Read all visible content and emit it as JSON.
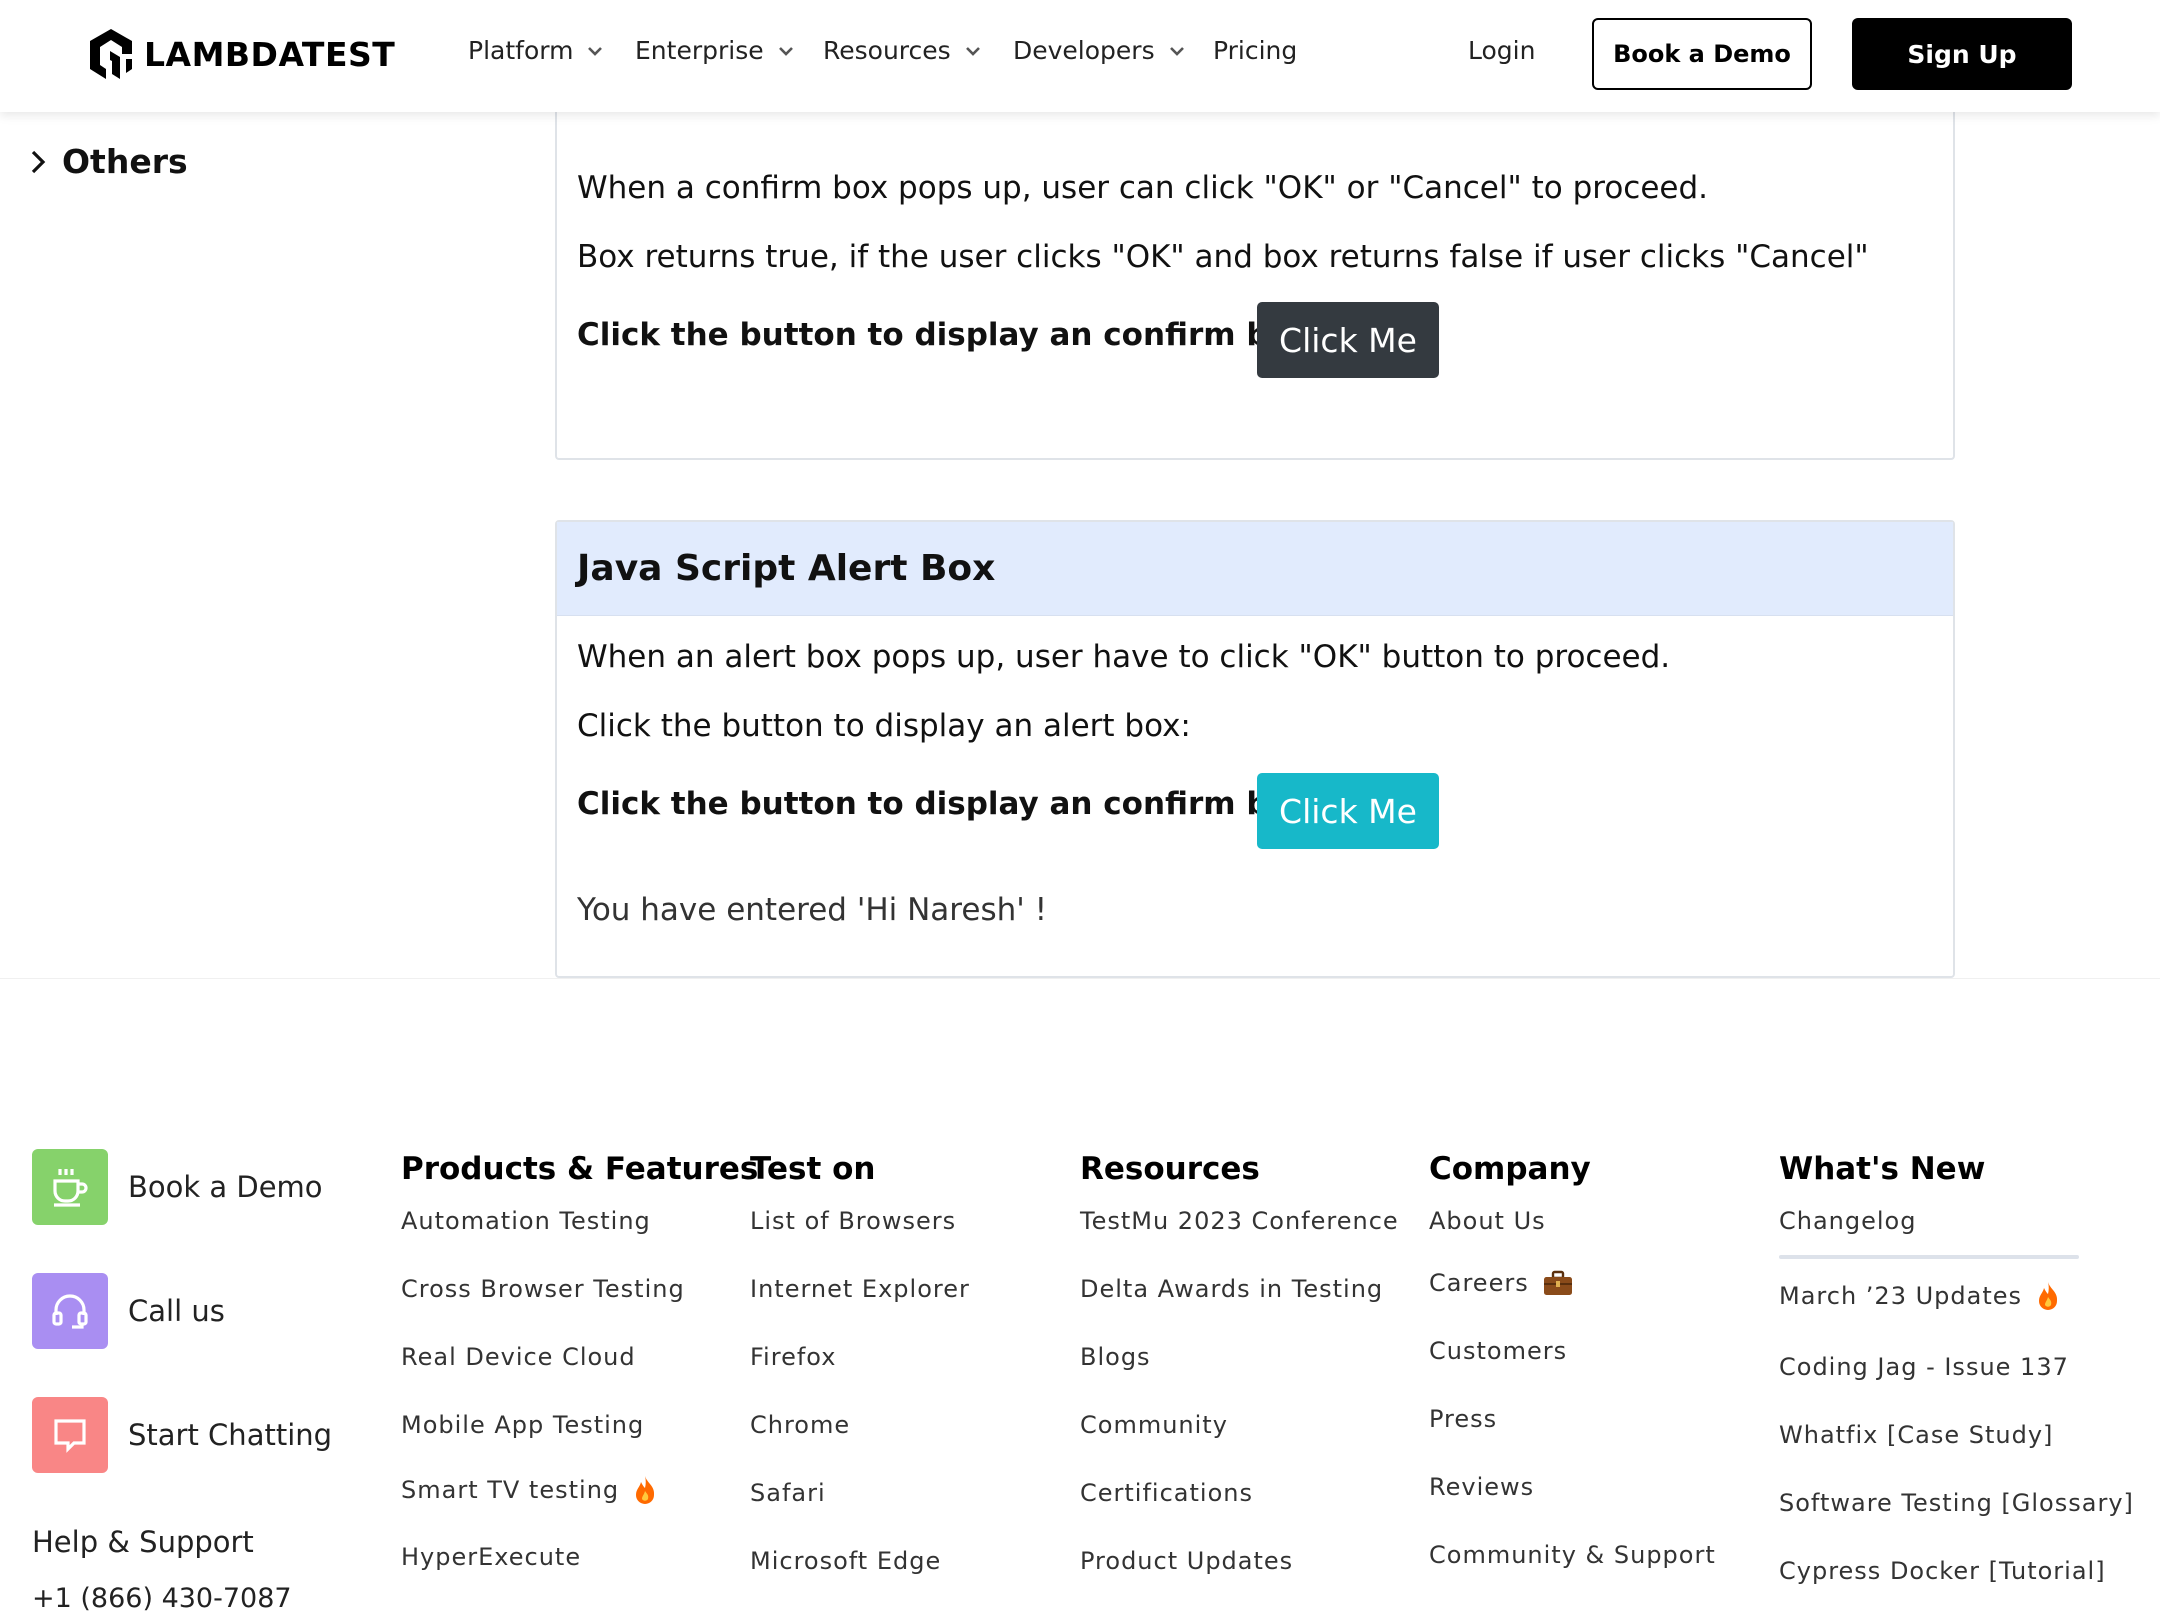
{
  "header": {
    "logo_text": "LAMBDATEST",
    "nav": [
      {
        "label": "Platform",
        "has_dropdown": true
      },
      {
        "label": "Enterprise",
        "has_dropdown": true
      },
      {
        "label": "Resources",
        "has_dropdown": true
      },
      {
        "label": "Developers",
        "has_dropdown": true
      },
      {
        "label": "Pricing",
        "has_dropdown": false
      }
    ],
    "login_label": "Login",
    "book_demo_label": "Book a Demo",
    "signup_label": "Sign Up"
  },
  "sidebar": {
    "others_label": "Others"
  },
  "confirm_card": {
    "line1": "When a confirm box pops up, user can click \"OK\" or \"Cancel\" to proceed.",
    "line2": "Box returns true, if the user clicks \"OK\" and box returns false if user clicks \"Cancel\"",
    "prompt": "Click the button to display an confirm box:",
    "button_label": "Click Me"
  },
  "alert_card": {
    "title": "Java Script Alert Box",
    "line1": "When an alert box pops up, user have to click \"OK\" button to proceed.",
    "line2": "Click the button to display an alert box:",
    "prompt": "Click the button to display an confirm box:",
    "button_label": "Click Me",
    "result_text": "You have entered 'Hi Naresh' !"
  },
  "footer": {
    "contacts": [
      {
        "label": "Book a Demo",
        "icon": "coffee-cup-icon",
        "color": "#86d26b"
      },
      {
        "label": "Call us",
        "icon": "headset-icon",
        "color": "#a98ef2"
      },
      {
        "label": "Start Chatting",
        "icon": "chat-bubble-icon",
        "color": "#f98686"
      }
    ],
    "help_label": "Help & Support",
    "phone": "+1 (866) 430-7087",
    "columns": {
      "products": {
        "title": "Products & Features",
        "links": [
          "Automation Testing",
          "Cross Browser Testing",
          "Real Device Cloud",
          "Mobile App Testing",
          "Smart TV testing",
          "HyperExecute"
        ]
      },
      "test_on": {
        "title": "Test on",
        "links": [
          "List of Browsers",
          "Internet Explorer",
          "Firefox",
          "Chrome",
          "Safari",
          "Microsoft Edge"
        ]
      },
      "resources": {
        "title": "Resources",
        "links": [
          "TestMu 2023 Conference",
          "Delta Awards in Testing",
          "Blogs",
          "Community",
          "Certifications",
          "Product Updates"
        ]
      },
      "company": {
        "title": "Company",
        "links": [
          "About Us",
          "Careers",
          "Customers",
          "Press",
          "Reviews",
          "Community & Support"
        ]
      },
      "whats_new": {
        "title": "What's New",
        "links": [
          "Changelog",
          "March ’23 Updates",
          "Coding Jag - Issue 137",
          "Whatfix [Case Study]",
          "Software Testing [Glossary]",
          "Cypress Docker [Tutorial]"
        ]
      }
    },
    "accent_colors": {
      "fire": "#ff6a00",
      "briefcase": "#8a4b1a"
    }
  }
}
